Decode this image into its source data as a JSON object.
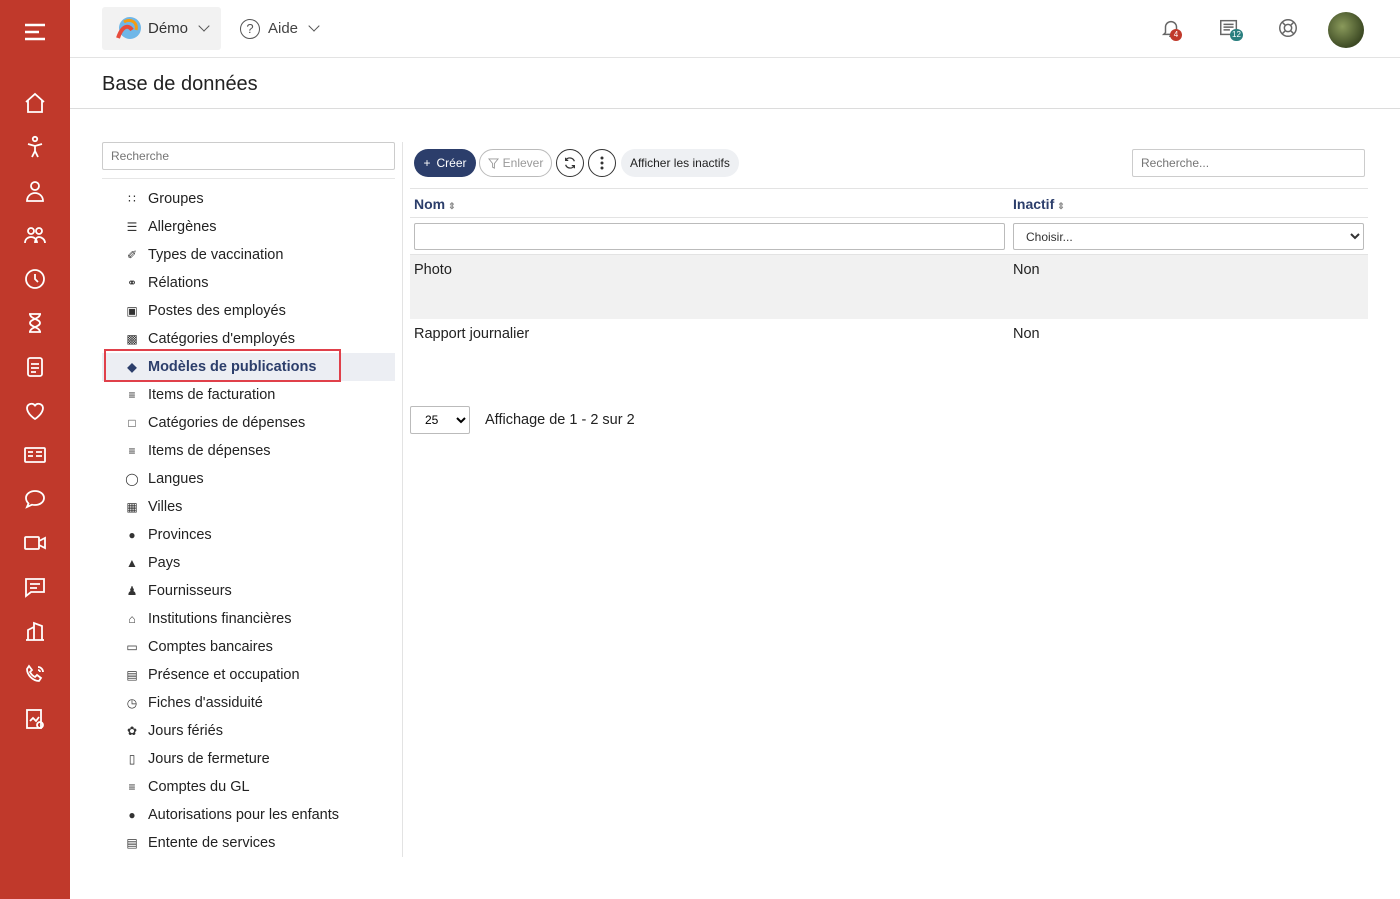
{
  "topbar": {
    "org_label": "Démo",
    "help_label": "Aide",
    "notifications_badge": "4",
    "news_badge": "12"
  },
  "page": {
    "title": "Base de données"
  },
  "sidebar": {
    "search_placeholder": "Recherche",
    "items": [
      {
        "label": "Groupes",
        "icon": "grid-icon"
      },
      {
        "label": "Allergènes",
        "icon": "allergen-icon"
      },
      {
        "label": "Types de vaccination",
        "icon": "syringe-icon"
      },
      {
        "label": "Rélations",
        "icon": "people-icon"
      },
      {
        "label": "Postes des employés",
        "icon": "id-badge-icon"
      },
      {
        "label": "Catégories d'employés",
        "icon": "employee-card-icon"
      },
      {
        "label": "Modèles de publications",
        "icon": "tag-icon",
        "active": true
      },
      {
        "label": "Items de facturation",
        "icon": "list-icon"
      },
      {
        "label": "Catégories de dépenses",
        "icon": "folder-icon"
      },
      {
        "label": "Items de dépenses",
        "icon": "list-icon"
      },
      {
        "label": "Langues",
        "icon": "globe-icon"
      },
      {
        "label": "Villes",
        "icon": "city-icon"
      },
      {
        "label": "Provinces",
        "icon": "p-circle-icon"
      },
      {
        "label": "Pays",
        "icon": "landscape-icon"
      },
      {
        "label": "Fournisseurs",
        "icon": "supplier-icon"
      },
      {
        "label": "Institutions financières",
        "icon": "bank-icon"
      },
      {
        "label": "Comptes bancaires",
        "icon": "wallet-icon"
      },
      {
        "label": "Présence et occupation",
        "icon": "attendance-icon"
      },
      {
        "label": "Fiches d'assiduité",
        "icon": "alarm-icon"
      },
      {
        "label": "Jours fériés",
        "icon": "leaf-icon"
      },
      {
        "label": "Jours de fermeture",
        "icon": "door-icon"
      },
      {
        "label": "Comptes du GL",
        "icon": "list-icon"
      },
      {
        "label": "Autorisations pour les enfants",
        "icon": "exclamation-icon"
      },
      {
        "label": "Entente de services",
        "icon": "book-icon"
      }
    ]
  },
  "toolbar": {
    "create_label": "Créer",
    "remove_label": "Enlever",
    "show_inactive_label": "Afficher les inactifs",
    "search_placeholder": "Recherche..."
  },
  "table": {
    "columns": [
      "Nom",
      "Inactif"
    ],
    "filter_select_value": "Choisir...",
    "rows": [
      {
        "name": "Photo",
        "inactive": "Non"
      },
      {
        "name": "Rapport journalier",
        "inactive": "Non"
      }
    ]
  },
  "pagination": {
    "page_size": "25",
    "summary": "Affichage de 1 - 2 sur 2"
  },
  "colors": {
    "rail": "#c0392b",
    "primary": "#2c3e6b",
    "highlight": "#e0404a"
  }
}
